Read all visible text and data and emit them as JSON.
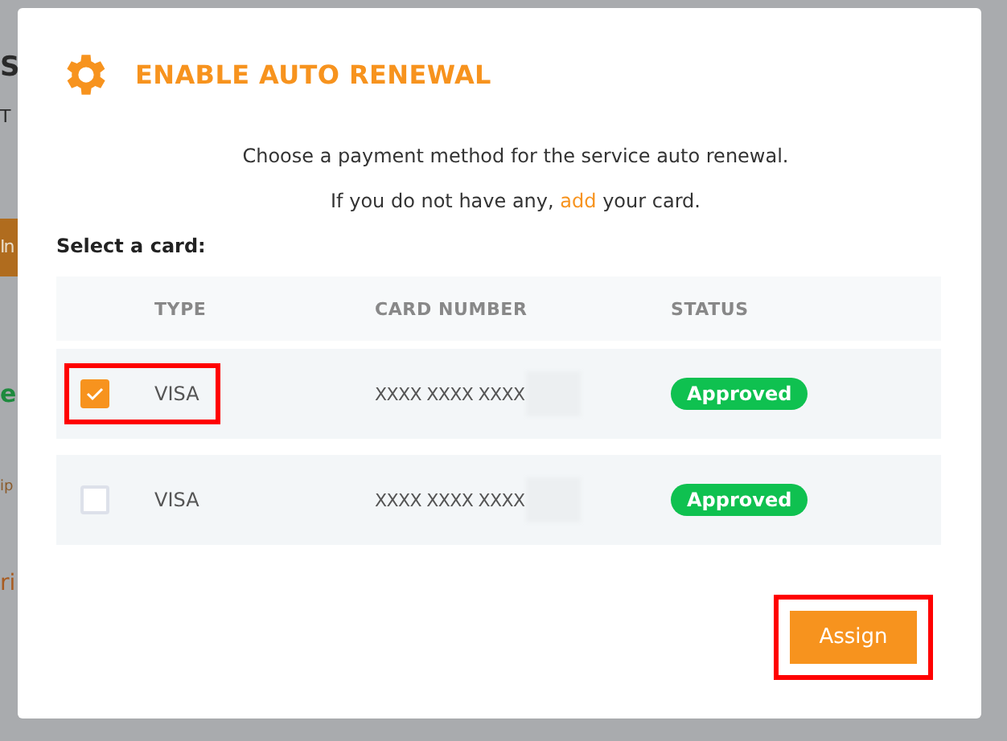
{
  "background_page": {
    "fragments": [
      {
        "kind": "heading",
        "text": "S"
      },
      {
        "kind": "text",
        "text": "T"
      },
      {
        "kind": "button",
        "text": "In"
      },
      {
        "kind": "green",
        "text": "e"
      },
      {
        "kind": "small",
        "text": "ip"
      },
      {
        "kind": "orange",
        "text": "ri"
      }
    ]
  },
  "dialog": {
    "title": "ENABLE AUTO RENEWAL",
    "message": "Choose a payment method for the service auto renewal.",
    "hint": {
      "before": "If you do not have any, ",
      "link": "add",
      "after": " your card."
    },
    "select_label": "Select a card:",
    "table": {
      "columns": [
        "TYPE",
        "CARD NUMBER",
        "STATUS"
      ],
      "rows": [
        {
          "checked": true,
          "highlighted": true,
          "type": "VISA",
          "card_number": "XXXX XXXX XXXX",
          "status": "Approved"
        },
        {
          "checked": false,
          "highlighted": false,
          "type": "VISA",
          "card_number": "XXXX XXXX XXXX",
          "status": "Approved"
        }
      ]
    },
    "assign_button": {
      "label": "Assign",
      "highlighted": true
    }
  }
}
